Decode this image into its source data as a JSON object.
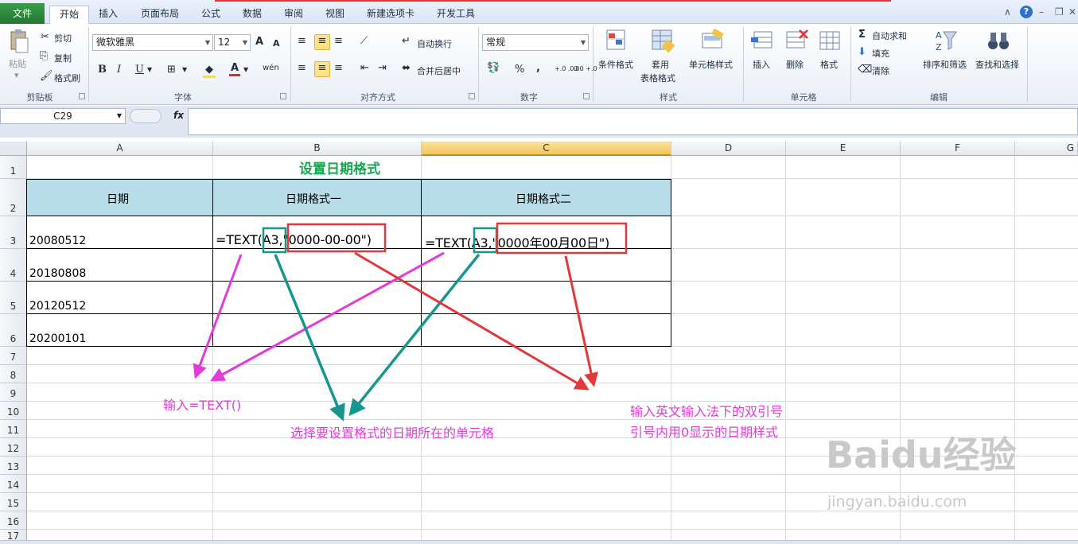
{
  "tabs": {
    "file": "文件",
    "items": [
      "开始",
      "插入",
      "页面布局",
      "公式",
      "数据",
      "审阅",
      "视图",
      "新建选项卡",
      "开发工具"
    ]
  },
  "clipboard": {
    "paste": "粘贴",
    "cut": "剪切",
    "copy": "复制",
    "format_painter": "格式刷",
    "group": "剪贴板"
  },
  "font": {
    "name": "微软雅黑",
    "size": "12",
    "grow": "A",
    "shrink": "A",
    "bold": "B",
    "italic": "I",
    "underline": "U",
    "color_letter": "A",
    "phonetic": "wén",
    "group": "字体"
  },
  "alignment": {
    "wrap": "自动换行",
    "merge": "合并后居中",
    "group": "对齐方式"
  },
  "number": {
    "format": "常规",
    "percent": "%",
    "comma": ",",
    "inc_decimal": "+.0 .00",
    "dec_decimal": ".00 +.0",
    "group": "数字"
  },
  "styles": {
    "conditional": "条件格式",
    "table_line1": "套用",
    "table_line2": "表格格式",
    "cell_styles": "单元格样式",
    "group": "样式"
  },
  "cells": {
    "insert": "插入",
    "delete": "删除",
    "format": "格式",
    "group": "单元格"
  },
  "editing": {
    "autosum": "自动求和",
    "fill": "填充",
    "clear": "清除",
    "sort": "排序和筛选",
    "find": "查找和选择",
    "group": "编辑"
  },
  "formula_bar": {
    "name_box": "C29",
    "fx": "fx",
    "content": ""
  },
  "columns": [
    "A",
    "B",
    "C",
    "D",
    "E",
    "F",
    "G"
  ],
  "rows": [
    "1",
    "2",
    "3",
    "4",
    "5",
    "6",
    "7",
    "8",
    "9",
    "10",
    "11",
    "12",
    "13",
    "14",
    "15",
    "16",
    "17"
  ],
  "sheet": {
    "title": "设置日期格式",
    "header_date": "日期",
    "header_fmt1": "日期格式一",
    "header_fmt2": "日期格式二",
    "dates": [
      "20080512",
      "20180808",
      "20120512",
      "20200101"
    ],
    "formula1_prefix": "=TEXT(",
    "formula1_ref": "A3",
    "formula1_fmt": ",\"0000-00-00\"",
    "formula1_close": ")",
    "formula2_prefix": "=TEXT(",
    "formula2_ref": "A3",
    "formula2_fmt": ",\"0000年00月00日\"",
    "formula2_close": ")"
  },
  "annotations": {
    "input_text": "输入=TEXT()",
    "select_cell": "选择要设置格式的日期所在的单元格",
    "quote_line1": "输入英文输入法下的双引号",
    "quote_line2": "引号内用0显示的日期样式"
  },
  "watermark": {
    "brand": "Baidu经验",
    "url": "jingyan.baidu.com"
  },
  "colors": {
    "title_green": "#1aa650",
    "header_fill": "#b9dde8",
    "annot_magenta": "#e23bd6",
    "teal": "#16968f",
    "red": "#e3383a",
    "selected_col": "#f1c75a"
  }
}
